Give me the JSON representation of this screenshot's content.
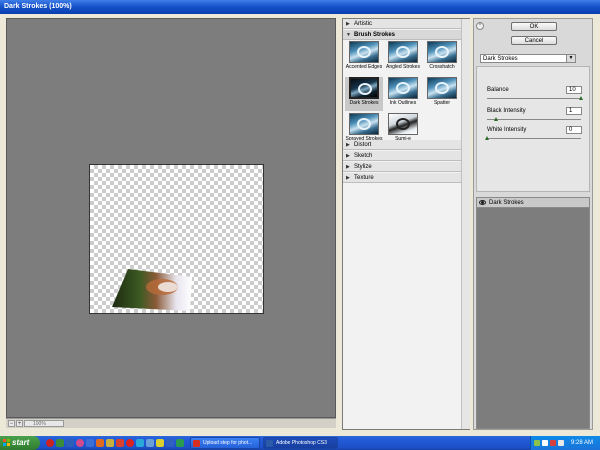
{
  "window": {
    "title": "Dark Strokes (100%)"
  },
  "preview": {
    "zoom": "100%"
  },
  "gallery": {
    "categories": [
      {
        "label": "Artistic",
        "open": false
      },
      {
        "label": "Brush Strokes",
        "open": true
      },
      {
        "label": "Distort",
        "open": false
      },
      {
        "label": "Sketch",
        "open": false
      },
      {
        "label": "Stylize",
        "open": false
      },
      {
        "label": "Texture",
        "open": false
      }
    ],
    "thumbs": [
      {
        "label": "Accented Edges"
      },
      {
        "label": "Angled Strokes"
      },
      {
        "label": "Crosshatch"
      },
      {
        "label": "Dark Strokes",
        "selected": true
      },
      {
        "label": "Ink Outlines"
      },
      {
        "label": "Spatter"
      },
      {
        "label": "Sprayed Strokes"
      },
      {
        "label": "Sumi-e"
      }
    ]
  },
  "buttons": {
    "ok": "OK",
    "cancel": "Cancel"
  },
  "filter": {
    "selected": "Dark Strokes"
  },
  "params": [
    {
      "label": "Balance",
      "value": "10",
      "fraction": 1.0
    },
    {
      "label": "Black Intensity",
      "value": "1",
      "fraction": 0.1
    },
    {
      "label": "White Intensity",
      "value": "0",
      "fraction": 0.0
    }
  ],
  "layers": {
    "items": [
      {
        "label": "Dark Strokes"
      }
    ]
  },
  "taskbar": {
    "start": "start",
    "tasks": [
      {
        "label": "Upload step for phot...",
        "active": false
      },
      {
        "label": "Adobe Photoshop CS3",
        "active": true
      }
    ],
    "clock": "9:28 AM"
  },
  "colors": {
    "titlebar": "#1450c8",
    "preview_bg": "#7d7d7d",
    "taskbar": "#245edb",
    "start": "#3c8f3c"
  }
}
